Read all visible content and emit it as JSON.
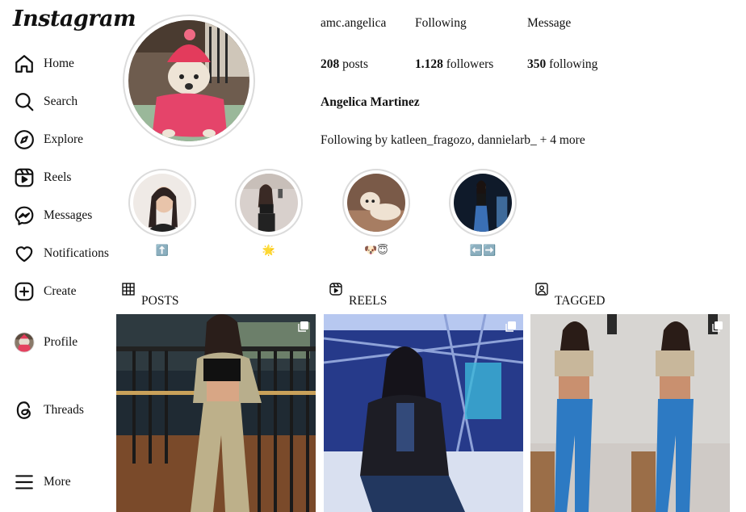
{
  "app": {
    "name": "Instagram"
  },
  "sidebar": {
    "items": [
      {
        "label": "Home",
        "icon": "home-icon"
      },
      {
        "label": "Search",
        "icon": "search-icon"
      },
      {
        "label": "Explore",
        "icon": "compass-icon"
      },
      {
        "label": "Reels",
        "icon": "reels-icon"
      },
      {
        "label": "Messages",
        "icon": "messenger-icon"
      },
      {
        "label": "Notifications",
        "icon": "heart-icon"
      },
      {
        "label": "Create",
        "icon": "plus-square-icon"
      },
      {
        "label": "Profile",
        "icon": "avatar"
      },
      {
        "label": "Threads",
        "icon": "threads-icon"
      },
      {
        "label": "More",
        "icon": "hamburger-icon"
      }
    ]
  },
  "profile": {
    "username": "amc.angelica",
    "following_button": "Following",
    "message_button": "Message",
    "posts_count": "208",
    "posts_label": "posts",
    "followers_count": "1.128",
    "followers_label": "followers",
    "following_count": "350",
    "following_label": "following",
    "full_name": "Angelica Martinez",
    "followed_by": "Following by katleen_fragozo, dannielarb_ + 4 more"
  },
  "highlights": [
    {
      "caption": "⬆️"
    },
    {
      "caption": "🌟"
    },
    {
      "caption": "🐶😇"
    },
    {
      "caption": "⬅️➡️"
    }
  ],
  "tabs": [
    {
      "label": "POSTS",
      "icon": "grid-icon"
    },
    {
      "label": "REELS",
      "icon": "reels-icon"
    },
    {
      "label": "TAGGED",
      "icon": "tagged-icon"
    }
  ],
  "colors": {
    "text": "#111111",
    "border": "#dbdbdb",
    "background": "#ffffff"
  }
}
